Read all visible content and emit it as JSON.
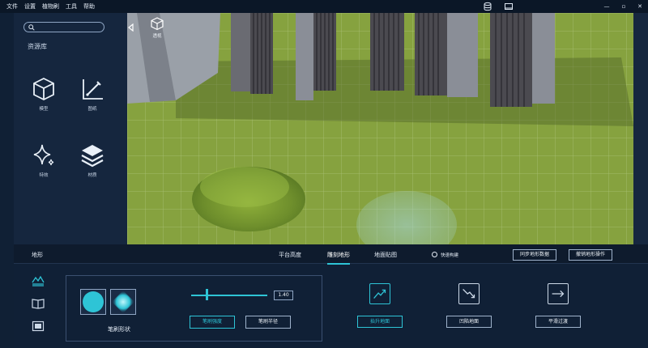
{
  "menu": [
    "文件",
    "设置",
    "植物刷",
    "工具",
    "帮助"
  ],
  "window_controls": {
    "minimize": "—",
    "restore": "▫",
    "close": "✕"
  },
  "sidebar": {
    "title": "资源库",
    "search_placeholder": "",
    "assets": [
      {
        "label": "模型",
        "icon": "cube-icon"
      },
      {
        "label": "图纸",
        "icon": "drawing-icon"
      },
      {
        "label": "特效",
        "icon": "sparkle-icon"
      },
      {
        "label": "材质",
        "icon": "layers-icon"
      }
    ]
  },
  "viewport": {
    "perspective_label": "透视"
  },
  "bottom": {
    "panel_label": "地形",
    "tabs": [
      "平台高度",
      "雕刻地形",
      "地面贴图"
    ],
    "active_tab": "雕刻地形",
    "fast_build_label": "快速构建",
    "sync_button": "同步地形数据",
    "undo_button": "撤销地形操作",
    "brush_shape_label": "笔刷形状",
    "slider_value": "1.40",
    "slider_fraction": 0.2,
    "param_buttons": [
      "笔刷强度",
      "笔刷半径"
    ],
    "active_param": "笔刷强度",
    "actions": [
      {
        "label": "抬升地面",
        "icon": "raise-icon"
      },
      {
        "label": "凹陷地面",
        "icon": "lower-icon"
      },
      {
        "label": "平滑过渡",
        "icon": "smooth-icon"
      }
    ],
    "active_action": "抬升地面"
  },
  "colors": {
    "accent": "#2ec4d6",
    "panel": "#15263e",
    "background": "#102035"
  }
}
